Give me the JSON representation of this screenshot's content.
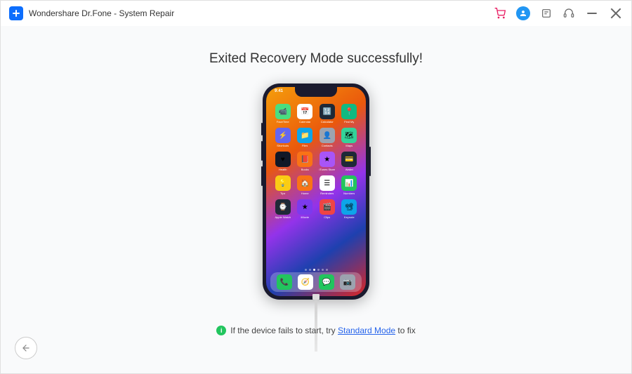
{
  "titlebar": {
    "app_title": "Wondershare Dr.Fone - System Repair"
  },
  "main": {
    "headline": "Exited Recovery Mode successfully!"
  },
  "phone": {
    "status_time": "9:41",
    "apps": [
      {
        "label": "FaceTime",
        "bg": "#4ade80",
        "glyph": "📹"
      },
      {
        "label": "Calendar",
        "bg": "#ffffff",
        "glyph": "📅"
      },
      {
        "label": "Calculator",
        "bg": "#1f2937",
        "glyph": "🔢"
      },
      {
        "label": "Find My",
        "bg": "#10b981",
        "glyph": "📍"
      },
      {
        "label": "Shortcuts",
        "bg": "#6366f1",
        "glyph": "⚡"
      },
      {
        "label": "Files",
        "bg": "#0ea5e9",
        "glyph": "📁"
      },
      {
        "label": "Contacts",
        "bg": "#9ca3af",
        "glyph": "👤"
      },
      {
        "label": "Maps",
        "bg": "#34d399",
        "glyph": "🗺"
      },
      {
        "label": "Health",
        "bg": "#111827",
        "glyph": "♥"
      },
      {
        "label": "Books",
        "bg": "#f97316",
        "glyph": "📕"
      },
      {
        "label": "iTunes Store",
        "bg": "#a855f7",
        "glyph": "★"
      },
      {
        "label": "Wallet",
        "bg": "#1f2937",
        "glyph": "💳"
      },
      {
        "label": "Tips",
        "bg": "#facc15",
        "glyph": "💡"
      },
      {
        "label": "Home",
        "bg": "#f97316",
        "glyph": "🏠"
      },
      {
        "label": "Reminders",
        "bg": "#ffffff",
        "glyph": "☰"
      },
      {
        "label": "Numbers",
        "bg": "#22c55e",
        "glyph": "📊"
      },
      {
        "label": "Apple Watch",
        "bg": "#1f2937",
        "glyph": "⌚"
      },
      {
        "label": "iMovie",
        "bg": "#7c3aed",
        "glyph": "★"
      },
      {
        "label": "Clips",
        "bg": "#ef4444",
        "glyph": "🎬"
      },
      {
        "label": "Keynote",
        "bg": "#0ea5e9",
        "glyph": "📽"
      }
    ],
    "dock": [
      {
        "label": "Phone",
        "bg": "#22c55e",
        "glyph": "📞"
      },
      {
        "label": "Safari",
        "bg": "#ffffff",
        "glyph": "🧭"
      },
      {
        "label": "Messages",
        "bg": "#22c55e",
        "glyph": "💬"
      },
      {
        "label": "Camera",
        "bg": "#9ca3af",
        "glyph": "📷"
      }
    ]
  },
  "hint": {
    "prefix": "If the device fails to start, try ",
    "link_text": "Standard Mode",
    "suffix": " to fix"
  }
}
